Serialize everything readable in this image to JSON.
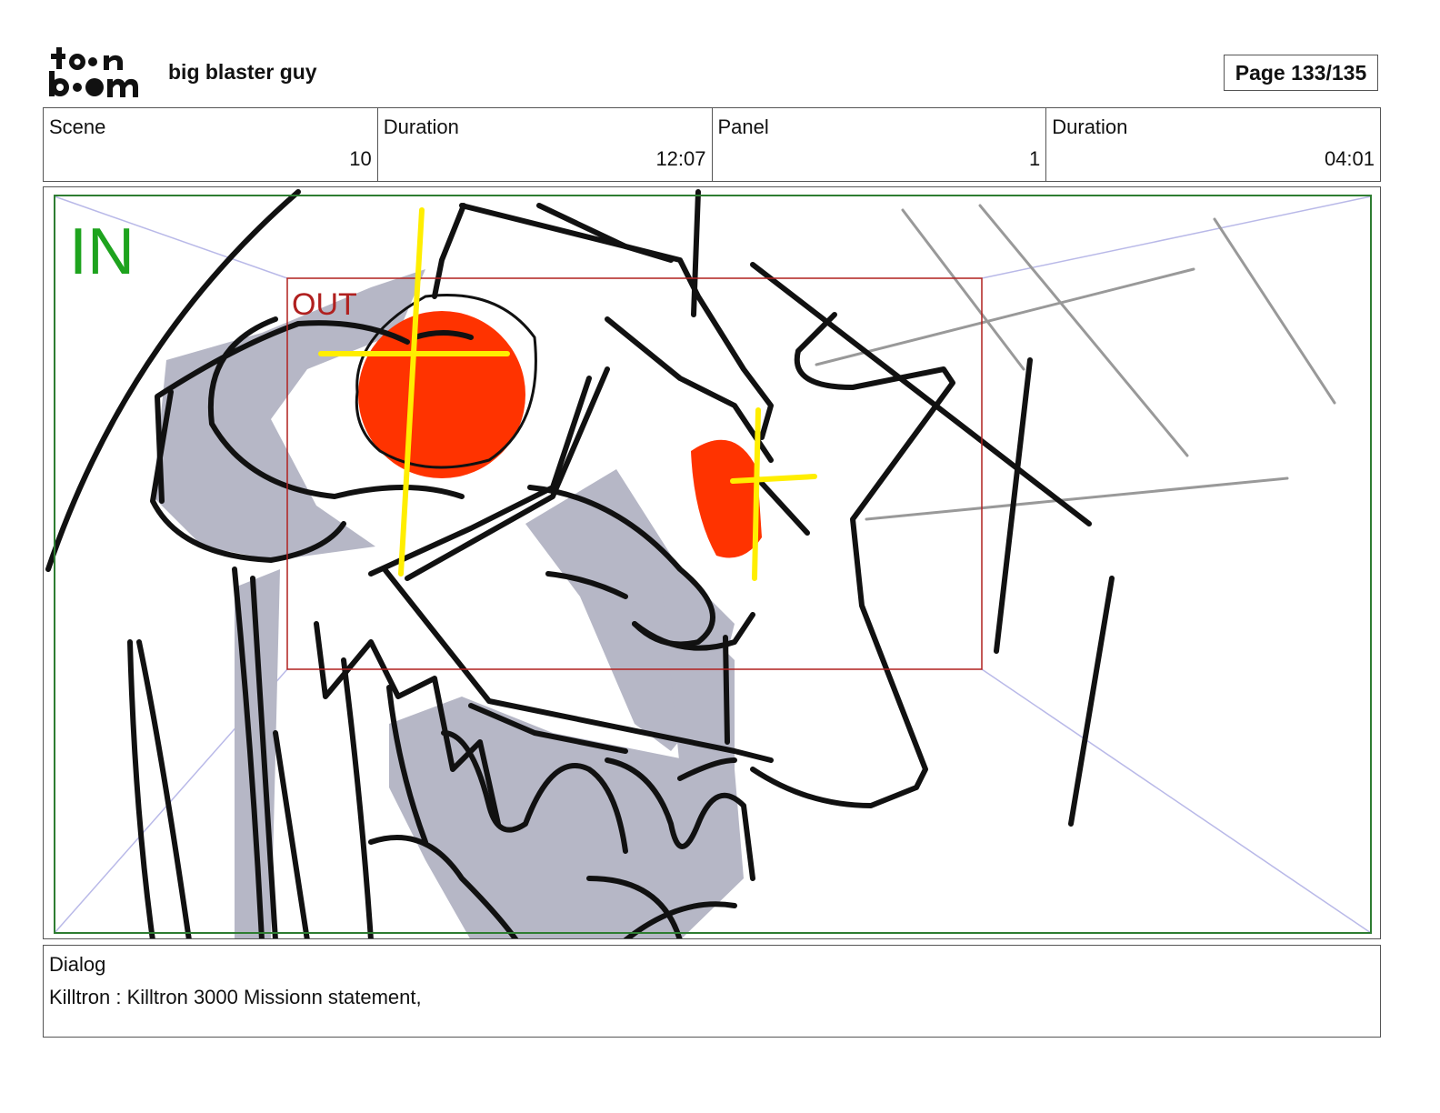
{
  "header": {
    "logo_text": "toon boom",
    "project_title": "big blaster guy",
    "page": "Page 133/135"
  },
  "info": {
    "scene_label": "Scene",
    "scene_value": "10",
    "scene_duration_label": "Duration",
    "scene_duration_value": "12:07",
    "panel_label": "Panel",
    "panel_value": "1",
    "panel_duration_label": "Duration",
    "panel_duration_value": "04:01"
  },
  "panel": {
    "in_label": "IN",
    "out_label": "OUT",
    "colors": {
      "in_frame": "#2e7d32",
      "out_frame": "#b0201f",
      "eye": "#ff3300",
      "crosshair": "#ffee00",
      "shadow": "#b6b7c6"
    }
  },
  "dialog": {
    "label": "Dialog",
    "text": "Killtron : Killtron 3000 Missionn statement,"
  }
}
